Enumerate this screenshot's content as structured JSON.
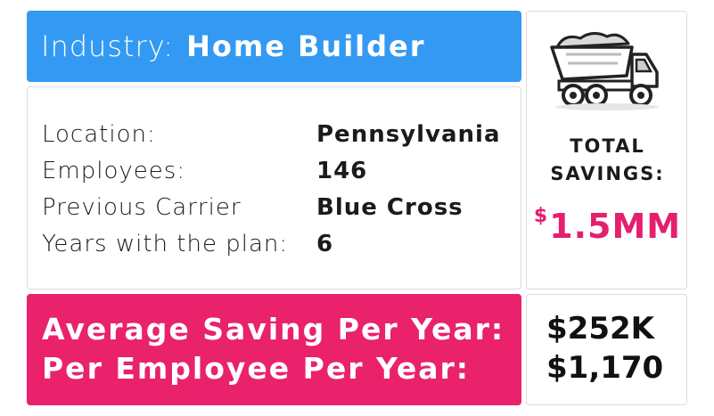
{
  "industry": {
    "label": "Industry:",
    "value": "Home Builder"
  },
  "details": [
    {
      "label": "Location:",
      "value": "Pennsylvania"
    },
    {
      "label": "Employees:",
      "value": "146"
    },
    {
      "label": "Previous Carrier",
      "value": "Blue Cross"
    },
    {
      "label": "Years with the plan:",
      "value": "6"
    }
  ],
  "savings": {
    "icon": "dump-truck-icon",
    "label_line1": "TOTAL",
    "label_line2": "SAVINGS:",
    "currency": "$",
    "amount": "1.5MM"
  },
  "averages": {
    "per_year_label": "Average Saving Per Year:",
    "per_employee_label": "Per Employee Per Year:",
    "per_year_value": "$252K",
    "per_employee_value": "$1,170"
  },
  "colors": {
    "blue": "#3399f3",
    "pink": "#e9226b",
    "accent_text": "#e51e6e"
  }
}
